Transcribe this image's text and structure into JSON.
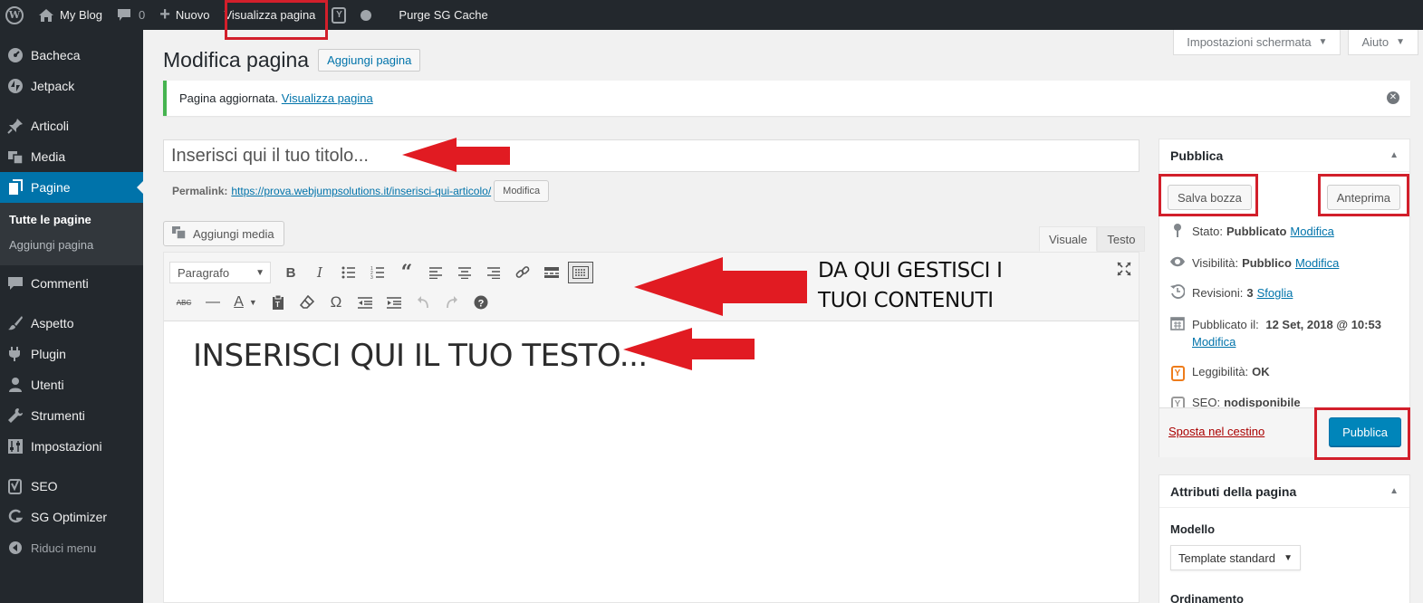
{
  "adminbar": {
    "site_name": "My Blog",
    "comments_count": "0",
    "new_label": "Nuovo",
    "view_page": "Visualizza pagina",
    "purge": "Purge SG Cache",
    "wp_logo_glyph": "W",
    "yoast_glyph": "Y"
  },
  "sidebar": {
    "items": [
      {
        "label": "Bacheca",
        "icon": "dashboard-icon"
      },
      {
        "label": "Jetpack",
        "icon": "jetpack-icon"
      },
      {
        "label": "Articoli",
        "icon": "pin-icon"
      },
      {
        "label": "Media",
        "icon": "media-icon"
      },
      {
        "label": "Pagine",
        "icon": "pages-icon"
      },
      {
        "label": "Commenti",
        "icon": "comment-icon"
      },
      {
        "label": "Aspetto",
        "icon": "brush-icon"
      },
      {
        "label": "Plugin",
        "icon": "plugin-icon"
      },
      {
        "label": "Utenti",
        "icon": "user-icon"
      },
      {
        "label": "Strumenti",
        "icon": "wrench-icon"
      },
      {
        "label": "Impostazioni",
        "icon": "settings-icon"
      },
      {
        "label": "SEO",
        "icon": "yoast-icon"
      },
      {
        "label": "SG Optimizer",
        "icon": "sg-optimizer-icon"
      }
    ],
    "submenu": [
      "Tutte le pagine",
      "Aggiungi pagina"
    ],
    "collapse": "Riduci menu"
  },
  "screen_meta": {
    "options": "Impostazioni schermata",
    "help": "Aiuto"
  },
  "page": {
    "title": "Modifica pagina",
    "add_new": "Aggiungi pagina"
  },
  "notice": {
    "text": "Pagina aggiornata.",
    "link": "Visualizza pagina"
  },
  "editor": {
    "title_placeholder": "Inserisci qui il tuo titolo...",
    "permalink_label": "Permalink:",
    "permalink_url": "https://prova.webjumpsolutions.it/inserisci-qui-articolo/",
    "permalink_edit": "Modifica",
    "add_media": "Aggiungi media",
    "tab_visual": "Visuale",
    "tab_text": "Testo",
    "format": "Paragrafo",
    "body_text": "INSERISCI QUI IL TUO TESTO..."
  },
  "publish": {
    "title": "Pubblica",
    "save_draft": "Salva bozza",
    "preview": "Anteprima",
    "status_label": "Stato:",
    "status_value": "Pubblicato",
    "visibility_label": "Visibilità:",
    "visibility_value": "Pubblico",
    "revisions_label": "Revisioni:",
    "revisions_value": "3",
    "revisions_link": "Sfoglia",
    "published_label": "Pubblicato il:",
    "published_value": "12 Set, 2018 @ 10:53",
    "edit_link": "Modifica",
    "readability_label": "Leggibilità:",
    "readability_value": "OK",
    "seo_label": "SEO:",
    "seo_value": "nodisponibile",
    "trash": "Sposta nel cestino",
    "publish_btn": "Pubblica"
  },
  "attributes": {
    "title": "Attributi della pagina",
    "template_label": "Modello",
    "template_value": "Template standard",
    "order_label": "Ordinamento"
  },
  "annotations": {
    "manage_line1": "DA QUI GESTISCI I",
    "manage_line2": "TUOI CONTENUTI",
    "highlight_color": "#d21f2b",
    "arrow_color": "#e11b22"
  }
}
